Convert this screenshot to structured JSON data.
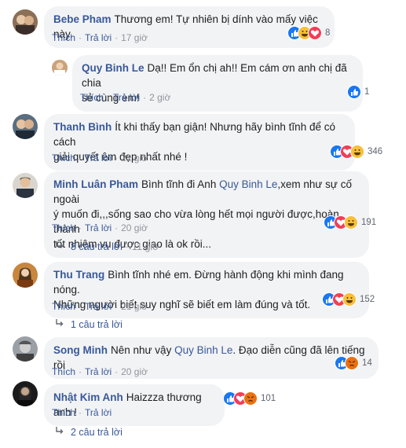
{
  "common": {
    "like_label": "Thích",
    "reply_label": "Trả lời",
    "dot": "·"
  },
  "comments": [
    {
      "author": "Bebe Pham",
      "text": "Thương em! Tự nhiên bị dính vào mấy việc này.",
      "time": "17 giờ",
      "reaction_count": "8"
    },
    {
      "author": "Quy Binh Le",
      "text_line1": "Dạ!! Em ổn chị ah!! Em cám ơn anh chị đã chia",
      "text_line2": "sẻ cùng em!",
      "time": "2 giờ",
      "reaction_count": "1"
    },
    {
      "author": "Thanh Bình",
      "text_line1": "Ít khi thấy bạn giận! Nhưng hãy bình tĩnh để có cách",
      "text_line2": "giải quyết êm đẹp nhất nhé !",
      "time": "21 giờ",
      "reaction_count": "346"
    },
    {
      "author": "Minh Luân Pham",
      "text_line1a": "Bình tĩnh đi Anh ",
      "mention": "Quy Binh Le",
      "text_line1b": ",xem như sự cố ngoài",
      "text_line2": "ý muốn đi,,,sống sao cho vừa lòng hết mọi người được,hoàn thành",
      "text_line3": "tốt nhiệm vụ được giao là ok rồi...",
      "time": "20 giờ",
      "reaction_count": "191",
      "replies_label": "8 câu trả lời",
      "replies_time": "11 giờ"
    },
    {
      "author": "Thu Trang",
      "text_line1": "Bình tĩnh nhé em. Đừng hành động khi mình đang nóng.",
      "text_line2": "Những người biết suy nghĩ sẽ biết em làm đúng và tốt.",
      "time": "21 giờ",
      "reaction_count": "152",
      "replies_label": "1 câu trả lời"
    },
    {
      "author": "Song Minh",
      "text_a": "Nên như vậy ",
      "mention": "Quy Binh Le",
      "text_b": ". Đạo diễn cũng đã lên tiếng rồi",
      "time": "20 giờ",
      "reaction_count": "14"
    },
    {
      "author": "Nhật Kim Anh",
      "text": "Haizzza thương anh !",
      "time": "",
      "reaction_count": "101",
      "replies_label": "2 câu trả lời"
    }
  ]
}
